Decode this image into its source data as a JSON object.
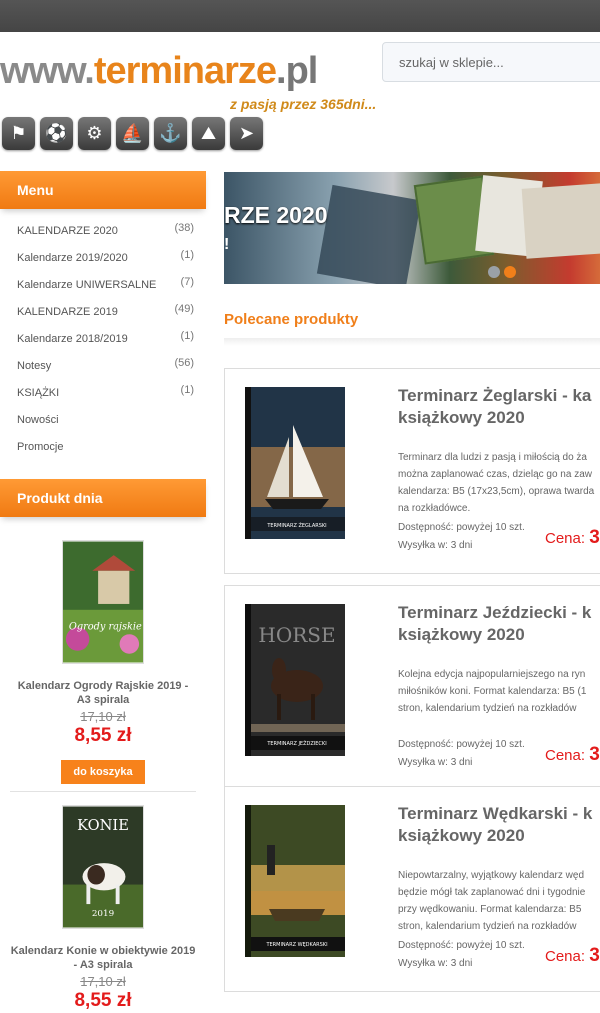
{
  "header": {
    "logo": {
      "prefix": "www.",
      "name": "terminarze",
      "suffix": ".pl"
    },
    "tagline": "z pasją przez 365dni...",
    "sport_icons": [
      "athletics-icon",
      "football-icon",
      "cycling-icon",
      "sailing-icon",
      "fishing-icon",
      "hiking-icon",
      "running-icon"
    ],
    "search_placeholder": "szukaj w sklepie..."
  },
  "sidebar": {
    "menu_title": "Menu",
    "menu": [
      {
        "label": "KALENDARZE 2020",
        "count": "(38)"
      },
      {
        "label": "Kalendarze 2019/2020",
        "count": "(1)"
      },
      {
        "label": "Kalendarze UNIWERSALNE",
        "count": "(7)"
      },
      {
        "label": "KALENDARZE 2019",
        "count": "(49)"
      },
      {
        "label": "Kalendarze 2018/2019",
        "count": "(1)"
      },
      {
        "label": "Notesy",
        "count": "(56)"
      },
      {
        "label": "KSIĄŻKI",
        "count": "(1)"
      },
      {
        "label": "Nowości",
        "count": ""
      },
      {
        "label": "Promocje",
        "count": ""
      }
    ],
    "product_day_title": "Produkt dnia",
    "product_day": [
      {
        "name": "Kalendarz Ogrody Rajskie 2019 - A3 spirala",
        "old_price": "17,10 zł",
        "price": "8,55 zł",
        "cart": "do koszyka",
        "cover_text": "Ogrody rajskie"
      },
      {
        "name": "Kalendarz Konie w obiektywie 2019 - A3 spirala",
        "old_price": "17,10 zł",
        "price": "8,55 zł",
        "cover_text": "KONIE",
        "cover_year": "2019"
      }
    ]
  },
  "banner": {
    "headline": "RZE 2020",
    "tail": "!"
  },
  "section_title": "Polecane produkty",
  "products": [
    {
      "title": "Terminarz Żeglarski - ka książkowy 2020",
      "desc": "Terminarz dla ludzi z pasją i miłością do ża\nmożna zaplanować czas, dzieląc go na zaw\nkalendarza: B5 (17x23,5cm), oprawa twarda\nna rozkładówce.",
      "avail": "Dostępność: powyżej 10 szt.",
      "ship": "Wysyłka w: 3 dni",
      "price_label": "Cena:",
      "price": "3",
      "cover_label": "TERMINARZ ŻEGLARSKI"
    },
    {
      "title": "Terminarz Jeździecki - k książkowy 2020",
      "desc": "Kolejna edycja najpopularniejszego na ryn\nmiłośników koni. Format kalendarza: B5 (1\nstron, kalendarium tydzień na rozkładów",
      "avail": "Dostępność: powyżej 10 szt.",
      "ship": "Wysyłka w: 3 dni",
      "price_label": "Cena:",
      "price": "3",
      "cover_label": "TERMINARZ JEŹDZIECKI",
      "cover_word": "HORSE"
    },
    {
      "title": "Terminarz Wędkarski - k książkowy 2020",
      "desc": "Niepowtarzalny, wyjątkowy kalendarz węd\nbędzie mógł tak zaplanować dni i tygodnie\nprzy wędkowaniu. Format kalendarza: B5\nstron, kalendarium tydzień na rozkładów",
      "avail": "Dostępność: powyżej 10 szt.",
      "ship": "Wysyłka w: 3 dni",
      "price_label": "Cena:",
      "price": "3",
      "cover_label": "TERMINARZ WĘDKARSKI"
    }
  ],
  "colors": {
    "accent": "#f07f1a",
    "price": "#e31b1b",
    "topbar": "#4a4a4a"
  }
}
